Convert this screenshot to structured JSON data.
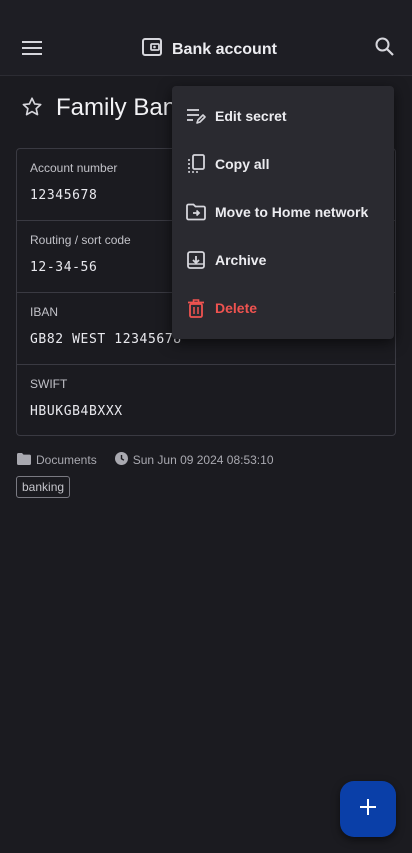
{
  "appbar": {
    "title": "Bank account",
    "icons": [
      "menu-icon",
      "wallet-icon",
      "search-icon"
    ]
  },
  "secret": {
    "name": "Family Bank"
  },
  "fields": [
    {
      "label": "Account number",
      "value": "12345678"
    },
    {
      "label": "Routing / sort code",
      "value": "12-34-56"
    },
    {
      "label": "IBAN",
      "value": "GB82 WEST 12345678"
    },
    {
      "label": "SWIFT",
      "value": "HBUKGB4BXXX"
    }
  ],
  "meta": {
    "folder": "Documents",
    "timestamp": "Sun Jun 09 2024 08:53:10"
  },
  "tags": [
    "banking"
  ],
  "menu": {
    "items": [
      {
        "label": "Edit secret",
        "icon": "edit-icon"
      },
      {
        "label": "Copy all",
        "icon": "copy-icon"
      },
      {
        "label": "Move to Home network",
        "icon": "move-folder-icon"
      },
      {
        "label": "Archive",
        "icon": "archive-icon"
      },
      {
        "label": "Delete",
        "icon": "delete-icon"
      }
    ]
  },
  "colors": {
    "accent": "#0a3fa8",
    "danger": "#ef5350",
    "background": "#1b1b20"
  }
}
